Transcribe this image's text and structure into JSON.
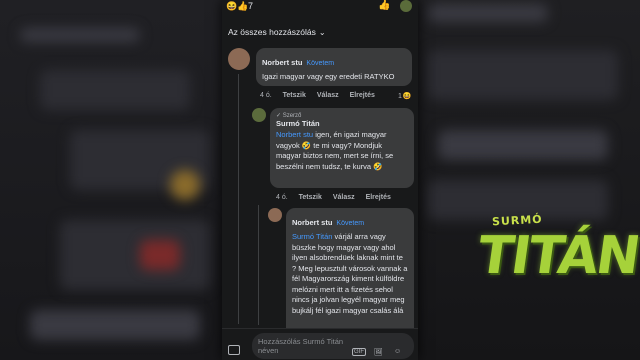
{
  "top": {
    "reaction_count": "7",
    "reaction_icons": "😆👍"
  },
  "filter": {
    "label": "Az összes hozzászólás"
  },
  "comment1": {
    "author": "Norbert stu",
    "follow": "Követem",
    "text": "Igazi magyar vagy egy eredeti RATYKO",
    "time": "4 ó.",
    "like": "Tetszik",
    "reply": "Válasz",
    "hide": "Elrejtés",
    "reaction_count": "1",
    "reaction_icon": "😆"
  },
  "comment2": {
    "badge": "✓ Szerző",
    "author": "Surmó Titán",
    "mention": "Norbert stu",
    "text": " igen, én igazi magyar vagyok 🤣 te mi vagy? Mondjuk magyar biztos nem, mert se írni, se beszélni nem tudsz, te kurva 🤣",
    "time": "4 ó.",
    "like": "Tetszik",
    "reply": "Válasz",
    "hide": "Elrejtés"
  },
  "comment3": {
    "author": "Norbert stu",
    "follow": "Követem",
    "mention": "Surmó Titán",
    "text": " várjál arra vagy büszke hogy magyar vagy ahol ilyen alsobrendüek laknak mint te ? Meg lepusztult városok vannak a fél Magyarország kiment külföldre melózni mert itt a fizetés sehol nincs ja jolvan legyél magyar meg bujkálj fél igazi magyar csalás álá"
  },
  "composer": {
    "placeholder": "Hozzászólás Surmó Titán néven"
  },
  "logo": {
    "top_text": "SURMÓ",
    "main_text": "TITÁN"
  }
}
